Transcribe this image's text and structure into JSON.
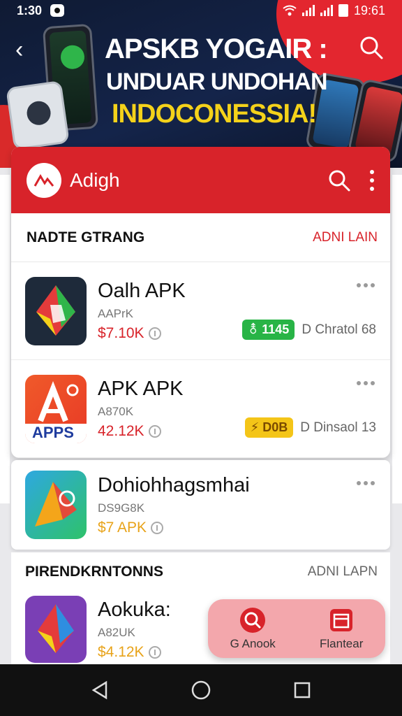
{
  "status_bar": {
    "time": "1:30",
    "battery_time": "19:61"
  },
  "banner": {
    "title": "APSKB YOGAIR :",
    "subtitle": "UNDUAR UNDOHAN",
    "highlight": "INDOCONESSIA!",
    "colors": {
      "highlight": "#f4d21a",
      "accent": "#e3262f"
    }
  },
  "app_header": {
    "name": "Adigh",
    "color": "#d8232a"
  },
  "section1": {
    "title": "NADTE GTRANG",
    "link": "ADNI LAIN"
  },
  "apps": [
    {
      "title": "Oalh APK",
      "dev": "AAPrK",
      "size": "$7.10K",
      "size_color": "#d8232a",
      "pill": "⚨ 1145",
      "pill_color": "#28b446",
      "meta": "D Chratol 68"
    },
    {
      "title": "APK APK",
      "dev": "A870K",
      "size": "42.12K",
      "size_color": "#d8232a",
      "pill": "⚡ D0B",
      "pill_color": "#f4c518",
      "meta": "D Dinsaol 13",
      "icon_text": "APPS"
    },
    {
      "title": "Dohiohhagsmhai",
      "dev": "DS9G8K",
      "size": "$7 APK",
      "size_color": "#e8a319"
    }
  ],
  "section2": {
    "title": "PIRENDKRNTONNS",
    "link": "ADNI LAPN"
  },
  "apps2": [
    {
      "title": "Aokuka:",
      "dev": "A82UK",
      "size": "$4.12K",
      "size_color": "#e8a319"
    }
  ],
  "float_menu": {
    "item1": "G Anook",
    "item2": "Flantear"
  }
}
